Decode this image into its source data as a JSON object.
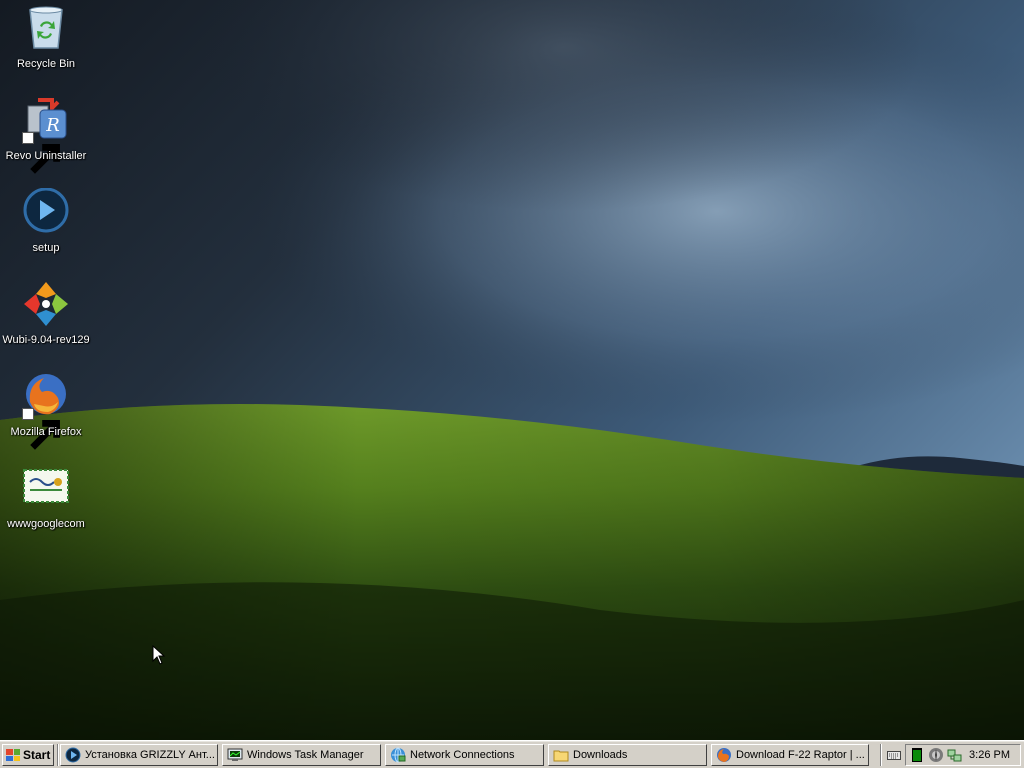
{
  "desktop": {
    "icons": [
      {
        "label": "Recycle Bin",
        "icon": "recycle-bin-icon",
        "shortcut": false
      },
      {
        "label": "Revo Uninstaller",
        "icon": "revo-uninstaller-icon",
        "shortcut": true
      },
      {
        "label": "setup",
        "icon": "play-icon",
        "shortcut": false
      },
      {
        "label": "Wubi-9.04-rev129",
        "icon": "wubi-icon",
        "shortcut": false
      },
      {
        "label": "Mozilla Firefox",
        "icon": "firefox-icon",
        "shortcut": true
      },
      {
        "label": "wwwgooglecom",
        "icon": "certificate-icon",
        "shortcut": false
      }
    ]
  },
  "taskbar": {
    "start_label": "Start",
    "tasks": [
      {
        "label": "Установка GRIZZLY Ант...",
        "icon": "setup-icon"
      },
      {
        "label": "Windows Task Manager",
        "icon": "task-manager-icon"
      },
      {
        "label": "Network Connections",
        "icon": "network-icon"
      },
      {
        "label": "Downloads",
        "icon": "folder-icon"
      },
      {
        "label": "Download F-22 Raptor | ...",
        "icon": "firefox-icon"
      }
    ],
    "tray": {
      "icons": [
        "keyboard-icon",
        "cpu-meter-icon",
        "antivirus-icon",
        "network-tray-icon"
      ],
      "clock": "3:26 PM"
    }
  },
  "colors": {
    "taskbar_bg": "#d4d0c8",
    "sky": "#2b3d55",
    "hill": "#4f7a1c",
    "label_text": "#ffffff"
  }
}
